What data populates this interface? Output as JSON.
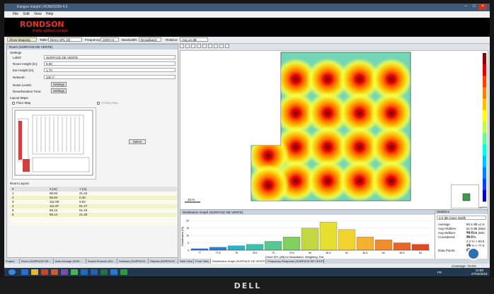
{
  "window": {
    "title": "Kangoo Insight | RONDSON 4.3"
  },
  "menu": [
    "File",
    "Edit",
    "View",
    "Help"
  ],
  "banner": {
    "brand": "RONDSON",
    "tagline": "Public address system"
  },
  "toolbar": {
    "show_mapping": "Show Mapping",
    "table_label": "Table:",
    "table_value": "Direct SPL [X]",
    "frequency_label": "Frequency:",
    "frequency_value": "1000 Hz",
    "bandwidth_label": "Bandwidth:",
    "bandwidth_value": "Broadband",
    "relative_label": "Relative:",
    "relative_value": "Avg ±3 dB"
  },
  "left_panel": {
    "title": "Room (SURFACE DE VENTE)",
    "settings_label": "Settings",
    "label_label": "Label:",
    "label_value": "SURFACE DE VENTE",
    "room_height_label": "Room Height [m]:",
    "room_height_value": "6.00",
    "ear_height_label": "Ear Height [m]:",
    "ear_height_value": "1.70",
    "network_label": "Network:",
    "network_value": "100 V",
    "noise_levels_label": "Noise Levels:",
    "settings_btn": "Settings",
    "reverb_label": "Reverberation Time:",
    "settings_btn2": "Settings",
    "layout_maps_label": "Layout Maps",
    "floor_map_label": "Floor Map",
    "ceiling_map_label": "Ceiling Map",
    "select_btn": "Select",
    "room_layout_label": "Room Layout",
    "columns": [
      "#",
      "X [m]",
      "Y [m]"
    ],
    "rows": [
      [
        "1",
        "55.94",
        "21.24"
      ],
      [
        "2",
        "55.94",
        "0.40"
      ],
      [
        "3",
        "111.08",
        "0.63"
      ],
      [
        "4",
        "111.97",
        "51.27"
      ],
      [
        "5",
        "66.12",
        "51.16"
      ],
      [
        "6",
        "66.14",
        "21.28"
      ]
    ]
  },
  "map": {
    "scale_label": "10 m",
    "legend_label": "dBSPL",
    "legend_colors": [
      "#8b0000",
      "#e00000",
      "#ff4000",
      "#ff8000",
      "#ffc000",
      "#ffff00",
      "#c0ff40",
      "#60ff90",
      "#00ffe0",
      "#00c0ff",
      "#0080ff",
      "#0040ff",
      "#0000c0"
    ],
    "legend_ticks": [
      "90",
      "88",
      "86",
      "84",
      "82",
      "80",
      "78",
      "76",
      "74",
      "72"
    ]
  },
  "dist_graph": {
    "title": "Distribution Graph (SURFACE DE VENTE)",
    "ylabel": "Distribution [%]",
    "xlabel": "Direct SPL [dB] for Broadband, Weighting: Flat"
  },
  "chart_data": {
    "type": "bar",
    "categories": [
      "77",
      "77.5",
      "78",
      "78.5",
      "79",
      "79.5",
      "80",
      "80.5",
      "81",
      "81.5",
      "82",
      "82.5",
      "83"
    ],
    "values": [
      1,
      2,
      3,
      4,
      6,
      9,
      15,
      19,
      14,
      9,
      7,
      5,
      4
    ],
    "ylim": [
      0,
      22
    ],
    "colors": [
      "#2e6fd8",
      "#2e7ed0",
      "#2db0c8",
      "#3fbfb0",
      "#58c890",
      "#82d060",
      "#c2d840",
      "#e5e030",
      "#f3d230",
      "#f6b030",
      "#f08c2a",
      "#e86424",
      "#e04a20"
    ],
    "grid": true
  },
  "stats": {
    "title": "Statistics",
    "selector": "3.0 dB Class Width",
    "rows": [
      [
        "Average:",
        "80.4 dB ±1.5"
      ],
      [
        "Avg+StdDev:",
        "81.9 dB (Max: 83.0)"
      ],
      [
        "Avg-StdDev:",
        "78.9 dB (Min: 76.6)"
      ],
      [
        "Considered:",
        "96.2 %"
      ],
      [
        "",
        "2.2 % > 83.5 dB"
      ],
      [
        "",
        "1.6 % < 77.0 dB"
      ],
      [
        "Data Points:",
        "5716"
      ]
    ]
  },
  "tabs": [
    "Project",
    "Room (SURFACE DE...",
    "Auto Arrange (SUR...",
    "Sound Sources (SU...",
    "Surfaces (SURFACE...",
    "Objects (SURFACE...",
    "Side View",
    "Front View",
    "Distribution Graph (SURFACE DE VENTE)",
    "Frequency Response (SURFACE DE VENTE)"
  ],
  "status": {
    "coverage": "Coverage: 72.6%"
  },
  "taskbar": {
    "lang": "FR",
    "time": "13:58",
    "date": "27/04/2018"
  },
  "bezel": {
    "brand": "DELL"
  }
}
